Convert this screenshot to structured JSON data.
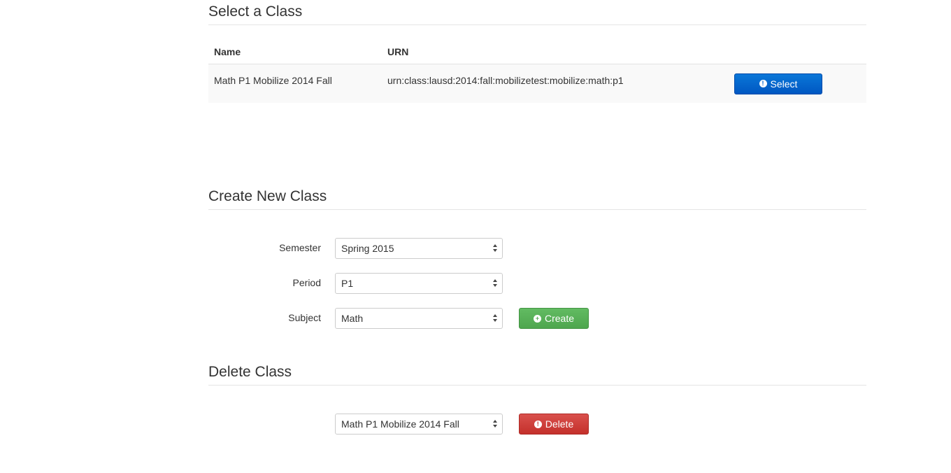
{
  "select_section": {
    "title": "Select a Class",
    "columns": [
      "Name",
      "URN"
    ],
    "rows": [
      {
        "name": "Math P1 Mobilize 2014 Fall",
        "urn": "urn:class:lausd:2014:fall:mobilizetest:mobilize:math:p1",
        "action_label": "Select"
      }
    ]
  },
  "create_section": {
    "title": "Create New Class",
    "semester_label": "Semester",
    "semester_value": "Spring 2015",
    "period_label": "Period",
    "period_value": "P1",
    "subject_label": "Subject",
    "subject_value": "Math",
    "create_label": "Create"
  },
  "delete_section": {
    "title": "Delete Class",
    "class_value": "Math P1 Mobilize 2014 Fall",
    "delete_label": "Delete"
  },
  "colors": {
    "primary": "#0062cc",
    "success": "#56ad56",
    "danger": "#c93a35"
  },
  "icons": {
    "select": "exclamation-circle-icon",
    "create": "plus-circle-icon",
    "delete": "exclamation-circle-icon",
    "dropdown": "select-arrows-icon"
  }
}
